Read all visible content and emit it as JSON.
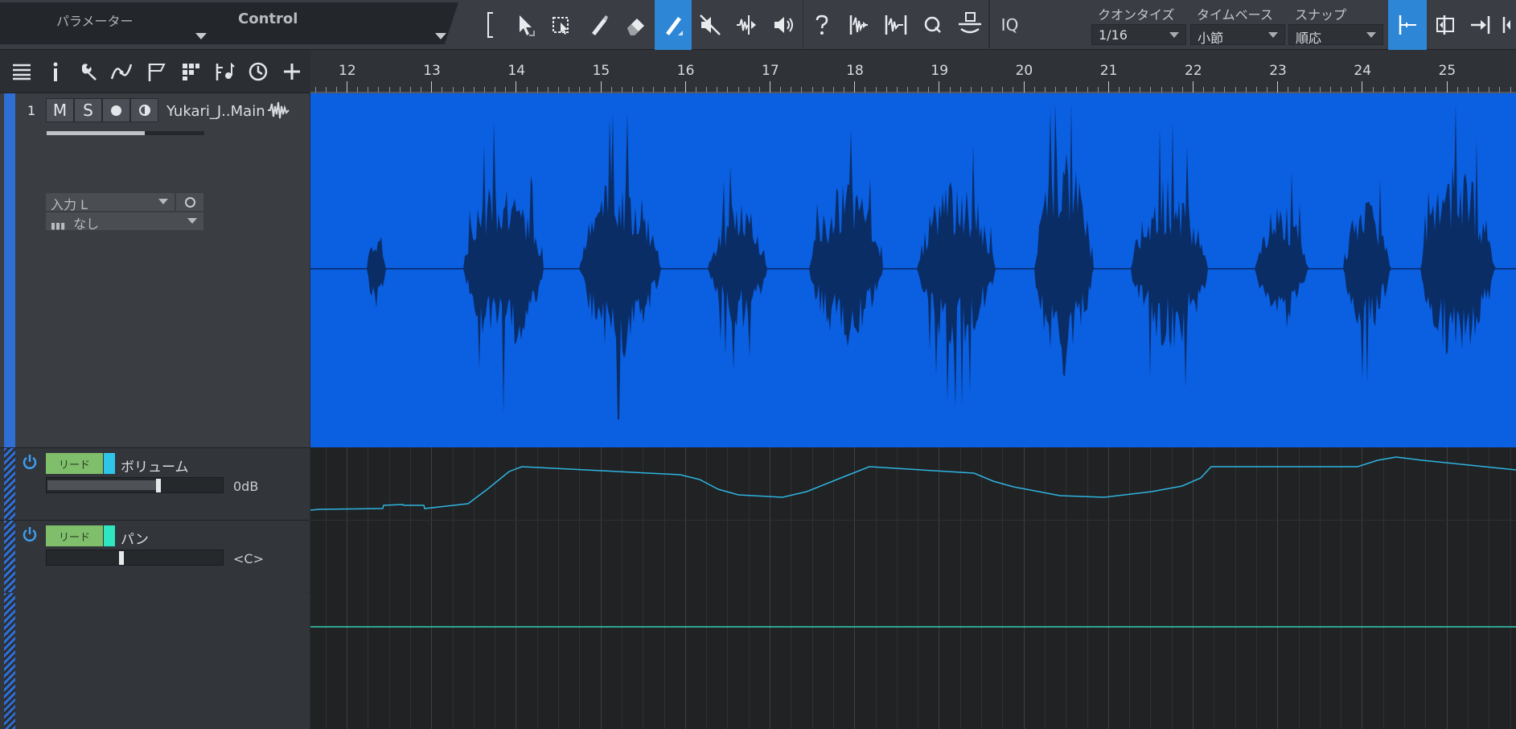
{
  "toolbar": {
    "parameter_label": "パラメーター",
    "control_label": "Control",
    "iq_label": "IQ",
    "quantize": {
      "label": "クオンタイズ",
      "value": "1/16"
    },
    "timebase": {
      "label": "タイムベース",
      "value": "小節"
    },
    "snap": {
      "label": "スナップ",
      "value": "順応"
    },
    "accent_color": "#2d86d6"
  },
  "track": {
    "number": "1",
    "mute_label": "M",
    "solo_label": "S",
    "name": "Yukari_J..Main",
    "input": "入力 L",
    "output": "なし",
    "volume_fraction": 0.62,
    "color": "#2f6ed3",
    "event_color": "#0b5fe1",
    "waveform_color": "#0a2d66"
  },
  "automation": [
    {
      "tag": "リード",
      "name": "ボリューム",
      "value": "0dB",
      "fader": 0.62,
      "swatch": "#2fc5e8",
      "line_color": "#2fb4e0"
    },
    {
      "tag": "リード",
      "name": "パン",
      "value": "<C>",
      "fader": 0.41,
      "swatch": "#2ee6c0",
      "line_color": "#35cfb5"
    }
  ],
  "ruler": {
    "bars": [
      "12",
      "13",
      "14",
      "15",
      "16",
      "17",
      "18",
      "19",
      "20",
      "21",
      "22",
      "23",
      "24",
      "25"
    ]
  }
}
